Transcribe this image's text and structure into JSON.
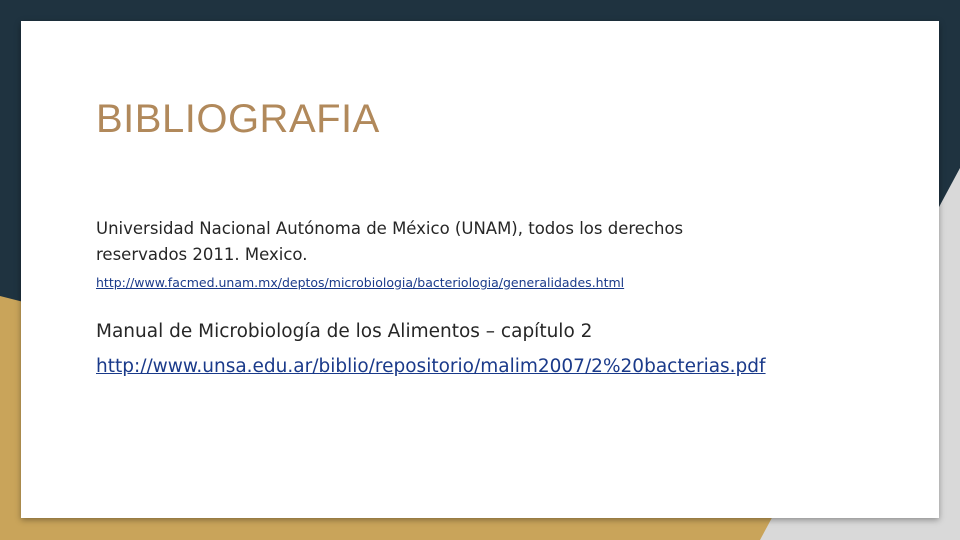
{
  "slide": {
    "title": "BIBLIOGRAFIA",
    "references": [
      {
        "lines": [
          "Universidad Nacional Autónoma de México (UNAM), todos los derechos",
          "reservados 2011. Mexico."
        ],
        "url": "http://www.facmed.unam.mx/deptos/microbiologia/bacteriologia/generalidades.html"
      },
      {
        "text": "Manual de Microbiología de los Alimentos – capítulo 2",
        "url": "http://www.unsa.edu.ar/biblio/repositorio/malim2007/2%20bacterias.pdf"
      }
    ]
  },
  "colors": {
    "background_dark": "#1f3340",
    "background_gold": "#c9a45a",
    "background_gray": "#d9d9d9",
    "title": "#b1895b",
    "link": "#1a3a8a",
    "text": "#262626"
  }
}
